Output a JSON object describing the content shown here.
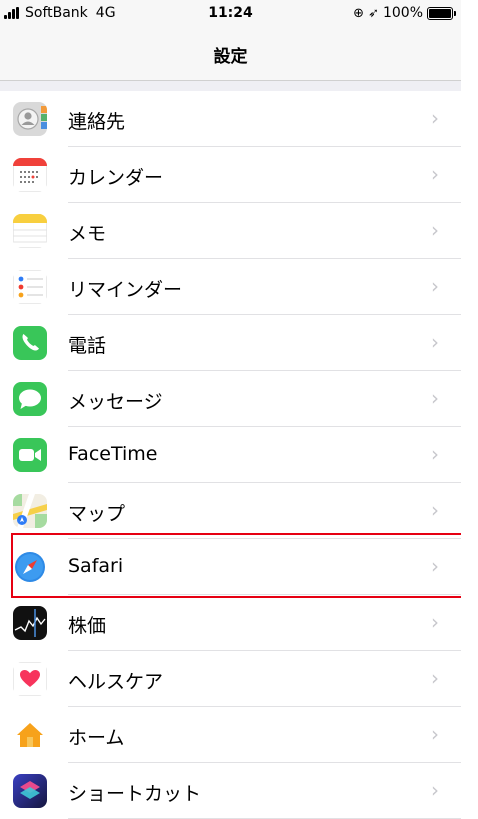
{
  "status_bar": {
    "carrier": "SoftBank",
    "network": "4G",
    "time": "11:24",
    "battery": "100%",
    "battery_level": 1.0
  },
  "nav": {
    "title": "設定"
  },
  "rows": [
    {
      "label": "連絡先",
      "icon": "contacts-icon"
    },
    {
      "label": "カレンダー",
      "icon": "calendar-icon"
    },
    {
      "label": "メモ",
      "icon": "notes-icon"
    },
    {
      "label": "リマインダー",
      "icon": "reminders-icon"
    },
    {
      "label": "電話",
      "icon": "phone-icon"
    },
    {
      "label": "メッセージ",
      "icon": "messages-icon"
    },
    {
      "label": "FaceTime",
      "icon": "facetime-icon"
    },
    {
      "label": "マップ",
      "icon": "maps-icon"
    },
    {
      "label": "Safari",
      "icon": "safari-icon",
      "highlighted": true
    },
    {
      "label": "株価",
      "icon": "stocks-icon"
    },
    {
      "label": "ヘルスケア",
      "icon": "health-icon"
    },
    {
      "label": "ホーム",
      "icon": "home-icon"
    },
    {
      "label": "ショートカット",
      "icon": "shortcuts-icon"
    }
  ],
  "chevron": "›",
  "colors": {
    "highlight_border": "#e60012",
    "chevron": "#c7c7cc"
  }
}
